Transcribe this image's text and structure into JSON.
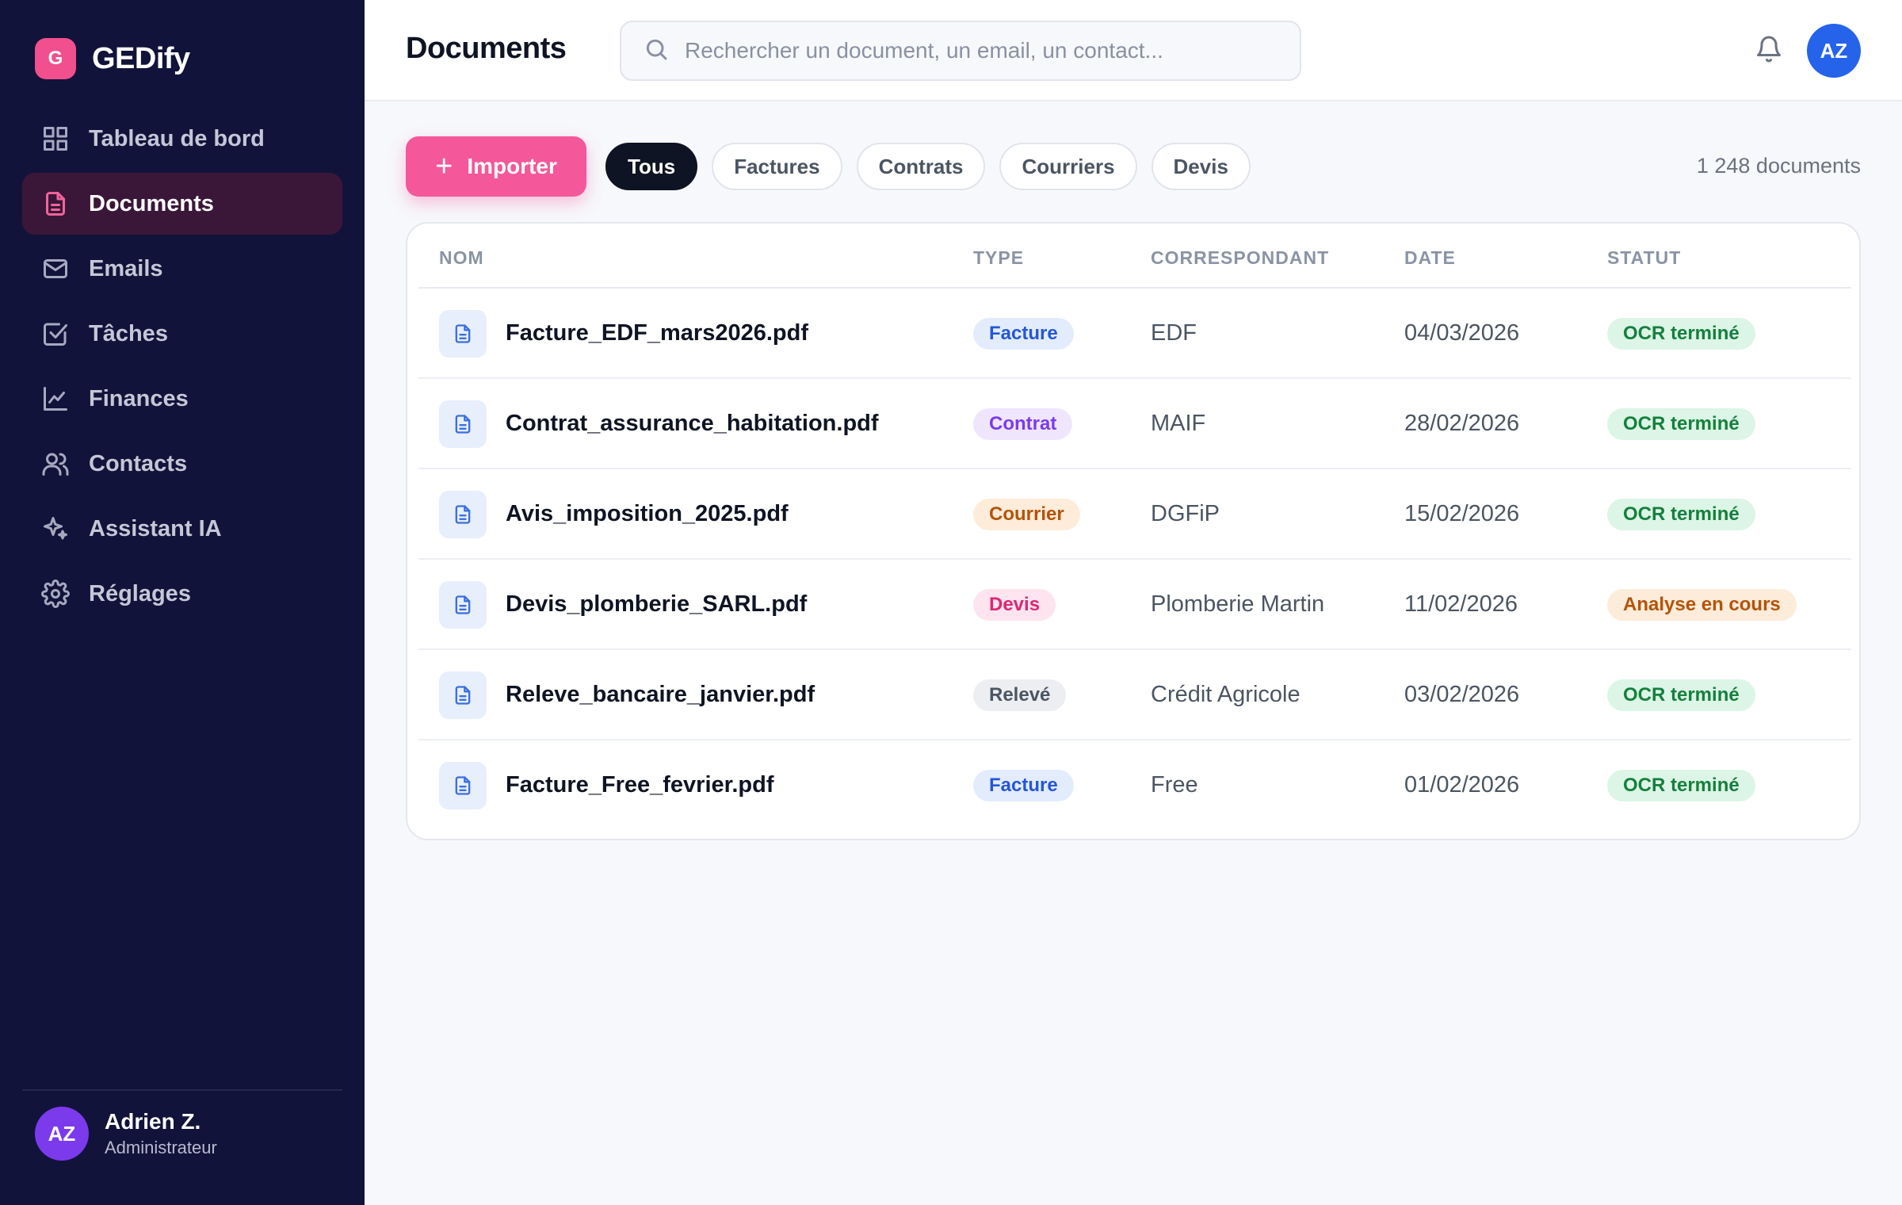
{
  "app": {
    "logo_letter": "G",
    "name": "GEDify"
  },
  "sidebar": {
    "items": [
      {
        "label": "Tableau de bord",
        "icon": "grid-icon",
        "active": false
      },
      {
        "label": "Documents",
        "icon": "document-icon",
        "active": true
      },
      {
        "label": "Emails",
        "icon": "mail-icon",
        "active": false
      },
      {
        "label": "Tâches",
        "icon": "checkbox-icon",
        "active": false
      },
      {
        "label": "Finances",
        "icon": "chart-line-icon",
        "active": false
      },
      {
        "label": "Contacts",
        "icon": "users-icon",
        "active": false
      },
      {
        "label": "Assistant IA",
        "icon": "sparkles-icon",
        "active": false
      },
      {
        "label": "Réglages",
        "icon": "gear-icon",
        "active": false
      }
    ],
    "user": {
      "initials": "AZ",
      "name": "Adrien Z.",
      "role": "Administrateur"
    }
  },
  "header": {
    "title": "Documents",
    "search_placeholder": "Rechercher un document, un email, un contact...",
    "avatar_initials": "AZ"
  },
  "toolbar": {
    "import_label": "Importer",
    "filters": [
      {
        "label": "Tous",
        "active": true
      },
      {
        "label": "Factures",
        "active": false
      },
      {
        "label": "Contrats",
        "active": false
      },
      {
        "label": "Courriers",
        "active": false
      },
      {
        "label": "Devis",
        "active": false
      }
    ],
    "count_label": "1 248 documents"
  },
  "table": {
    "headers": {
      "name": "NOM",
      "type": "TYPE",
      "correspondent": "CORRESPONDANT",
      "date": "DATE",
      "status": "STATUT"
    },
    "rows": [
      {
        "name": "Facture_EDF_mars2026.pdf",
        "type": "Facture",
        "correspondent": "EDF",
        "date": "04/03/2026",
        "status": "OCR terminé"
      },
      {
        "name": "Contrat_assurance_habitation.pdf",
        "type": "Contrat",
        "correspondent": "MAIF",
        "date": "28/02/2026",
        "status": "OCR terminé"
      },
      {
        "name": "Avis_imposition_2025.pdf",
        "type": "Courrier",
        "correspondent": "DGFiP",
        "date": "15/02/2026",
        "status": "OCR terminé"
      },
      {
        "name": "Devis_plomberie_SARL.pdf",
        "type": "Devis",
        "correspondent": "Plomberie Martin",
        "date": "11/02/2026",
        "status": "Analyse en cours"
      },
      {
        "name": "Releve_bancaire_janvier.pdf",
        "type": "Relevé",
        "correspondent": "Crédit Agricole",
        "date": "03/02/2026",
        "status": "OCR terminé"
      },
      {
        "name": "Facture_Free_fevrier.pdf",
        "type": "Facture",
        "correspondent": "Free",
        "date": "01/02/2026",
        "status": "OCR terminé"
      }
    ]
  },
  "colors": {
    "accent": "#f4579a",
    "sidebar_bg": "#12133a",
    "type_badges": {
      "Facture": {
        "bg": "#e3ecfd",
        "fg": "#2457d6"
      },
      "Contrat": {
        "bg": "#efe6fd",
        "fg": "#7c3aed"
      },
      "Courrier": {
        "bg": "#fdecd9",
        "fg": "#b45309"
      },
      "Devis": {
        "bg": "#fde4ee",
        "fg": "#db2777"
      },
      "Relevé": {
        "bg": "#eceef2",
        "fg": "#4b5563"
      }
    },
    "status_badges": {
      "OCR terminé": {
        "bg": "#dcf5e6",
        "fg": "#15803d"
      },
      "Analyse en cours": {
        "bg": "#fdecd9",
        "fg": "#b45309"
      }
    }
  }
}
